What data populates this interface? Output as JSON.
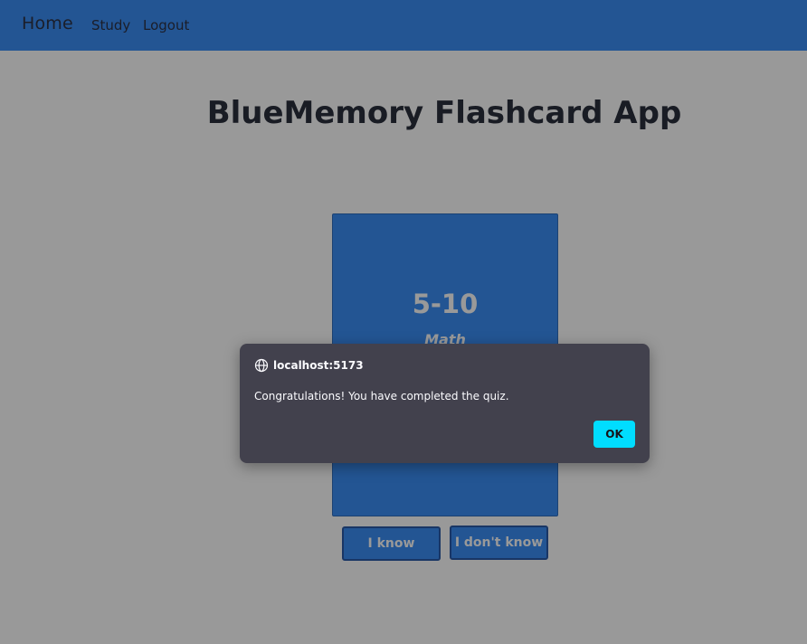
{
  "navbar": {
    "brand": "Home",
    "links": [
      "Study",
      "Logout"
    ]
  },
  "page": {
    "title": "BlueMemory Flashcard App"
  },
  "card": {
    "question": "5-10",
    "category": "Math"
  },
  "actions": {
    "know_label": "I know",
    "dont_know_label": "I don't know"
  },
  "dialog": {
    "origin": "localhost:5173",
    "message": "Congratulations! You have completed the quiz.",
    "ok_label": "OK",
    "origin_icon": "globe-icon"
  },
  "colors": {
    "navbar": "#3b8ef5",
    "card": "#3b8ef5",
    "dialog_bg": "#42414d",
    "ok_button": "#00ddff"
  }
}
